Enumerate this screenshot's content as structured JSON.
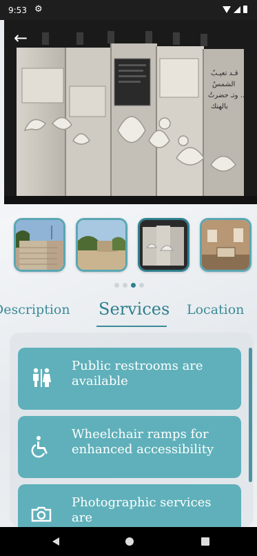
{
  "status_bar": {
    "time": "9:53"
  },
  "header": {
    "back_icon": "arrow-left-icon"
  },
  "hero": {
    "calligraphy_lines": [
      "قـد تعيـبُ",
      "الشمسُ",
      "وتـ حضرتُ ..",
      "بالهنك"
    ]
  },
  "gallery": {
    "thumbnails": [
      "stairs-trees",
      "building-garden",
      "exhibition-panels",
      "interior-room"
    ],
    "selected_index": 2,
    "page_count": 4,
    "active_page": 2
  },
  "tabs": [
    {
      "label": "Description"
    },
    {
      "label": "Services"
    },
    {
      "label": "Location"
    }
  ],
  "active_tab": 1,
  "services": [
    {
      "icon": "restroom-icon",
      "text": "Public restrooms are available"
    },
    {
      "icon": "wheelchair-icon",
      "text": "Wheelchair ramps for enhanced accessibility"
    },
    {
      "icon": "camera-icon",
      "text": "Photographic services are"
    }
  ],
  "colors": {
    "accent": "#2f7f8e",
    "card": "#5fb0ba",
    "status_bar": "#1e1e1e"
  }
}
